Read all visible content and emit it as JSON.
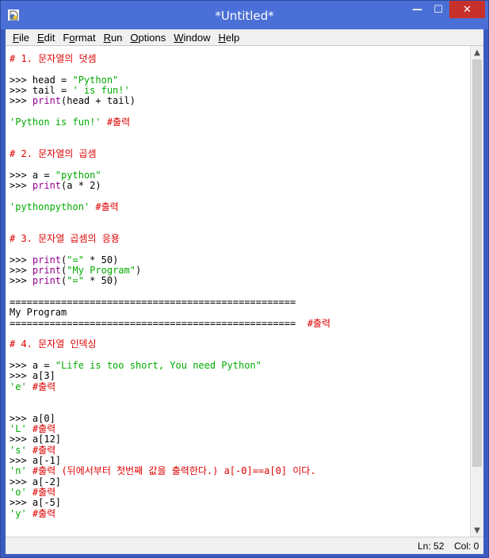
{
  "window": {
    "title": "*Untitled*",
    "minimize_glyph": "—",
    "maximize_glyph": "☐",
    "close_glyph": "✕",
    "icon": "python-idle-icon",
    "colors": {
      "titlebar": "#4a6fd6",
      "close": "#c7312b"
    }
  },
  "menu": [
    {
      "hot": "F",
      "rest": "ile"
    },
    {
      "hot": "E",
      "rest": "dit"
    },
    {
      "pre": "F",
      "hot": "o",
      "rest": "rmat"
    },
    {
      "hot": "R",
      "rest": "un"
    },
    {
      "hot": "O",
      "rest": "ptions"
    },
    {
      "hot": "W",
      "rest": "indow"
    },
    {
      "hot": "H",
      "rest": "elp"
    }
  ],
  "editor": {
    "lines": [
      [
        {
          "t": "# 1. 문자열의 덧셈",
          "c": "comment"
        }
      ],
      [],
      [
        {
          "t": ">>> head = ",
          "c": "normal"
        },
        {
          "t": "\"Python\"",
          "c": "string"
        }
      ],
      [
        {
          "t": ">>> tail = ",
          "c": "normal"
        },
        {
          "t": "' is fun!'",
          "c": "string"
        }
      ],
      [
        {
          "t": ">>> ",
          "c": "normal"
        },
        {
          "t": "print",
          "c": "keyword"
        },
        {
          "t": "(head + tail)",
          "c": "normal"
        }
      ],
      [],
      [
        {
          "t": "'Python is fun!'",
          "c": "string"
        },
        {
          "t": " #출력",
          "c": "comment"
        }
      ],
      [],
      [],
      [
        {
          "t": "# 2. 문자열의 곱셈",
          "c": "comment"
        }
      ],
      [],
      [
        {
          "t": ">>> a = ",
          "c": "normal"
        },
        {
          "t": "\"python\"",
          "c": "string"
        }
      ],
      [
        {
          "t": ">>> ",
          "c": "normal"
        },
        {
          "t": "print",
          "c": "keyword"
        },
        {
          "t": "(a * 2)",
          "c": "normal"
        }
      ],
      [],
      [
        {
          "t": "'pythonpython'",
          "c": "string"
        },
        {
          "t": " #출력",
          "c": "comment"
        }
      ],
      [],
      [],
      [
        {
          "t": "# 3. 문자열 곱셈의 응용",
          "c": "comment"
        }
      ],
      [],
      [
        {
          "t": ">>> ",
          "c": "normal"
        },
        {
          "t": "print",
          "c": "keyword"
        },
        {
          "t": "(",
          "c": "normal"
        },
        {
          "t": "\"=\"",
          "c": "string"
        },
        {
          "t": " * 50)",
          "c": "normal"
        }
      ],
      [
        {
          "t": ">>> ",
          "c": "normal"
        },
        {
          "t": "print",
          "c": "keyword"
        },
        {
          "t": "(",
          "c": "normal"
        },
        {
          "t": "\"My Program\"",
          "c": "string"
        },
        {
          "t": ")",
          "c": "normal"
        }
      ],
      [
        {
          "t": ">>> ",
          "c": "normal"
        },
        {
          "t": "print",
          "c": "keyword"
        },
        {
          "t": "(",
          "c": "normal"
        },
        {
          "t": "\"=\"",
          "c": "string"
        },
        {
          "t": " * 50)",
          "c": "normal"
        }
      ],
      [],
      [
        {
          "t": "==================================================",
          "c": "normal"
        }
      ],
      [
        {
          "t": "My Program",
          "c": "normal"
        }
      ],
      [
        {
          "t": "==================================================  ",
          "c": "normal"
        },
        {
          "t": "#출력",
          "c": "comment"
        }
      ],
      [],
      [
        {
          "t": "# 4. 문자열 인덱싱",
          "c": "comment"
        }
      ],
      [],
      [
        {
          "t": ">>> a = ",
          "c": "normal"
        },
        {
          "t": "\"Life is too short, You need Python\"",
          "c": "string"
        }
      ],
      [
        {
          "t": ">>> a[3]",
          "c": "normal"
        }
      ],
      [
        {
          "t": "'e'",
          "c": "string"
        },
        {
          "t": " #출력",
          "c": "comment"
        }
      ],
      [],
      [],
      [
        {
          "t": ">>> a[0]",
          "c": "normal"
        }
      ],
      [
        {
          "t": "'L'",
          "c": "string"
        },
        {
          "t": " #출력",
          "c": "comment"
        }
      ],
      [
        {
          "t": ">>> a[12]",
          "c": "normal"
        }
      ],
      [
        {
          "t": "'s'",
          "c": "string"
        },
        {
          "t": " #출력",
          "c": "comment"
        }
      ],
      [
        {
          "t": ">>> a[-1]",
          "c": "normal"
        }
      ],
      [
        {
          "t": "'n'",
          "c": "string"
        },
        {
          "t": " #출력 (뒤에서부터 첫번째 값을 출력한다.) a[-0]==a[0] 이다.",
          "c": "comment"
        }
      ],
      [
        {
          "t": ">>> a[-2]",
          "c": "normal"
        }
      ],
      [
        {
          "t": "'o'",
          "c": "string"
        },
        {
          "t": " #출력",
          "c": "comment"
        }
      ],
      [
        {
          "t": ">>> a[-5]",
          "c": "normal"
        }
      ],
      [
        {
          "t": "'y'",
          "c": "string"
        },
        {
          "t": " #출력",
          "c": "comment"
        }
      ]
    ],
    "colors": {
      "comment": "#dd0000",
      "string": "#00aa00",
      "keyword": "#900090",
      "normal": "#000000"
    }
  },
  "scrollbar": {
    "up_glyph": "▲",
    "down_glyph": "▼"
  },
  "status": {
    "ln": "Ln: 52",
    "col": "Col: 0"
  }
}
